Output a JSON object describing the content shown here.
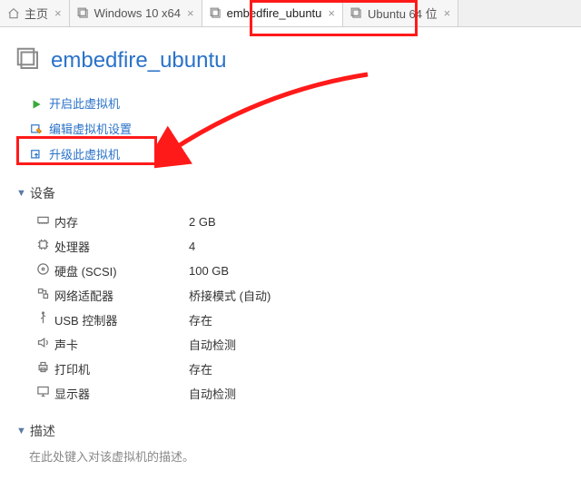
{
  "tabs": [
    {
      "label": "主页"
    },
    {
      "label": "Windows 10 x64"
    },
    {
      "label": "embedfire_ubuntu",
      "active": true
    },
    {
      "label": "Ubuntu 64 位"
    }
  ],
  "page_title": "embedfire_ubuntu",
  "actions": {
    "power_on": "开启此虚拟机",
    "edit_settings": "编辑虚拟机设置",
    "upgrade": "升级此虚拟机"
  },
  "sections": {
    "devices_header": "设备",
    "description_header": "描述"
  },
  "devices": {
    "memory": {
      "label": "内存",
      "value": "2 GB"
    },
    "cpu": {
      "label": "处理器",
      "value": "4"
    },
    "disk": {
      "label": "硬盘 (SCSI)",
      "value": "100 GB"
    },
    "network": {
      "label": "网络适配器",
      "value": "桥接模式 (自动)"
    },
    "usb": {
      "label": "USB 控制器",
      "value": "存在"
    },
    "sound": {
      "label": "声卡",
      "value": "自动检测"
    },
    "printer": {
      "label": "打印机",
      "value": "存在"
    },
    "display": {
      "label": "显示器",
      "value": "自动检测"
    }
  },
  "description_placeholder": "在此处键入对该虚拟机的描述。"
}
